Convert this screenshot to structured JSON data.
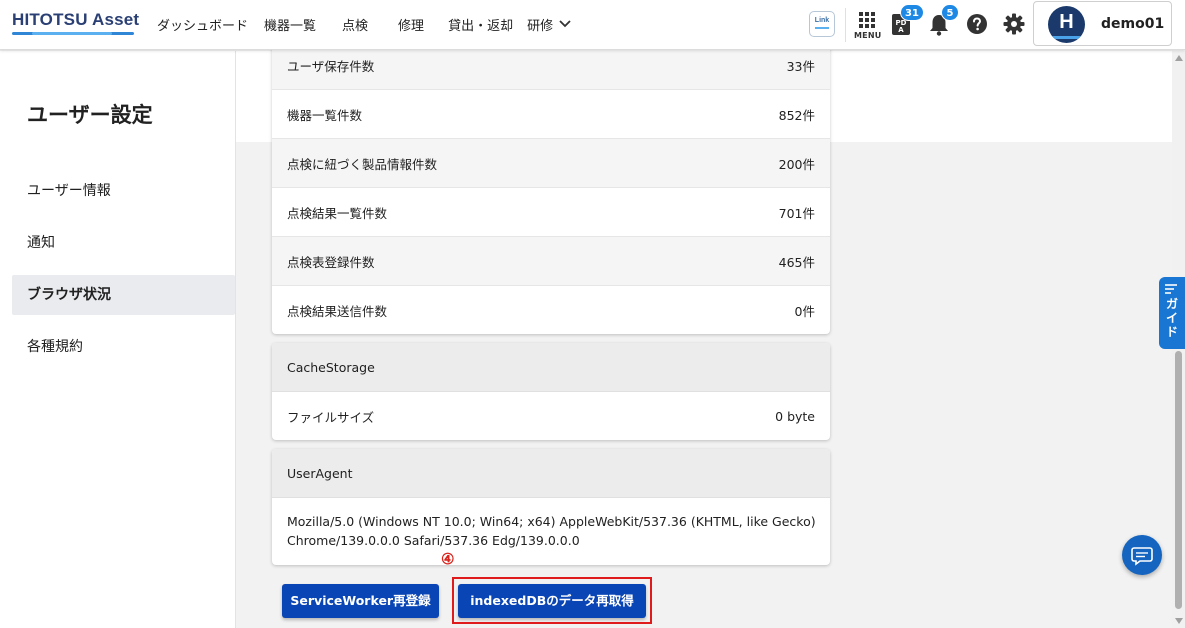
{
  "header": {
    "logo": "HITOTSU Asset",
    "nav": [
      "ダッシュボード",
      "機器一覧",
      "点検",
      "修理",
      "貸出・返却",
      "研修"
    ],
    "link_label": "Link",
    "menu_label": "MENU",
    "pda_label": "PDA",
    "pda_badge": "31",
    "bell_badge": "5",
    "user": {
      "initial": "H",
      "name": "demo01"
    }
  },
  "sidebar": {
    "title": "ユーザー設定",
    "items": [
      {
        "label": "ユーザー情報",
        "active": false
      },
      {
        "label": "通知",
        "active": false
      },
      {
        "label": "ブラウザ状況",
        "active": true
      },
      {
        "label": "各種規約",
        "active": false
      }
    ]
  },
  "counts": [
    {
      "label": "ユーザ保存件数",
      "value": "33件"
    },
    {
      "label": "機器一覧件数",
      "value": "852件"
    },
    {
      "label": "点検に紐づく製品情報件数",
      "value": "200件"
    },
    {
      "label": "点検結果一覧件数",
      "value": "701件"
    },
    {
      "label": "点検表登録件数",
      "value": "465件"
    },
    {
      "label": "点検結果送信件数",
      "value": "0件"
    }
  ],
  "cache": {
    "title": "CacheStorage",
    "label": "ファイルサイズ",
    "value": "0 byte"
  },
  "useragent": {
    "title": "UserAgent",
    "line1": "Mozilla/5.0 (Windows NT 10.0; Win64; x64) AppleWebKit/537.36 (KHTML, like Gecko)",
    "line2": "Chrome/139.0.0.0 Safari/537.36 Edg/139.0.0.0"
  },
  "annotation": "④",
  "buttons": {
    "serviceworker": "ServiceWorker再登録",
    "indexeddb": "indexedDBのデータ再取得"
  },
  "guide_label": "ガイド",
  "colors": {
    "primary": "#0a45b5",
    "accent": "#1976d2",
    "highlight": "#e01b1b",
    "logo": "#2a3f73"
  }
}
